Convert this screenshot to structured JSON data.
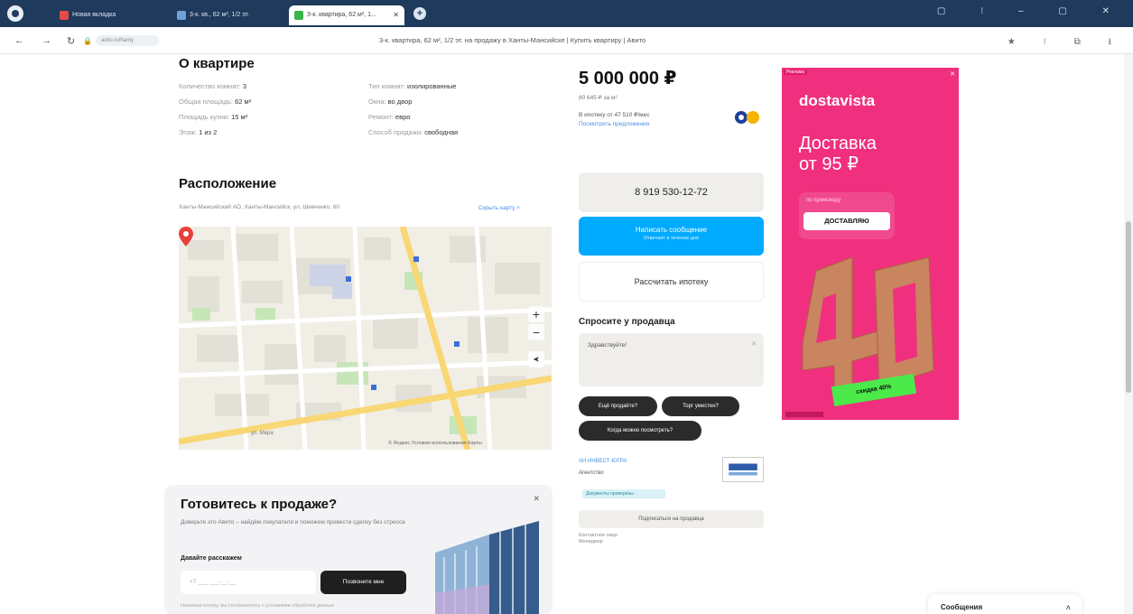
{
  "browser": {
    "tabs": [
      {
        "label": "Новая вкладка",
        "icon_color": "#e34a4a"
      },
      {
        "label": "3-к. кв., 62 м², 1/2 эт.",
        "icon_color": "#6fa0d8"
      },
      {
        "label": "3-к. квартира, 62 м², 1...",
        "icon_color": "#39b54a"
      }
    ],
    "page_title": "3-к. квартира, 62 м², 1/2 эт. на продажу в Ханты-Мансийске | Купить квартиру | Авито",
    "url_chip": "avito.ru/hanty",
    "new_tab_symbol": "+",
    "window_controls": "▢ ⁝ – ▢ ✕",
    "addr_right_icons": "★ ⁝ ⧉ ⭳",
    "nav_back": "←",
    "nav_forward": "→",
    "nav_reload": "↻",
    "nav_lock": "🔒"
  },
  "about": {
    "title": "О квартире",
    "left": [
      {
        "label": "Количество комнат: ",
        "value": "3"
      },
      {
        "label": "Общая площадь: ",
        "value": "62 м²"
      },
      {
        "label": "Площадь кухни: ",
        "value": "15 м²"
      },
      {
        "label": "Этаж: ",
        "value": "1 из 2"
      }
    ],
    "right": [
      {
        "label": "Тип комнат: ",
        "value": "изолированные"
      },
      {
        "label": "Окна: ",
        "value": "во двор"
      },
      {
        "label": "Ремонт: ",
        "value": "евро"
      },
      {
        "label": "Способ продажи: ",
        "value": "свободная"
      }
    ]
  },
  "location": {
    "title": "Расположение",
    "address": "Ханты-Мансийский АО, Ханты-Мансийск, ул. Шевченко, 60",
    "map_link": "Скрыть карту ˄",
    "zoom_in": "+",
    "zoom_out": "−",
    "locate": "➤",
    "map_copyright": "© Яндекс  Условия использования  Карты",
    "street_label": "ул. Мира"
  },
  "promo": {
    "title": "Готовитесь к продаже?",
    "desc": "Доверьте это Авито – найдём покупателя и поможем провести сделку без стресса",
    "input_label": "Давайте расскажем",
    "input_placeholder": "+7 ___ ___-__-__",
    "button": "Позвоните мне",
    "note": "Нажимая кнопку, вы соглашаетесь с условиями обработки данных",
    "close": "✕"
  },
  "price": {
    "value": "5 000 000 ₽",
    "per_meter": "80 645 ₽ за м²",
    "mortgage": "В ипотеку от 47 510 ₽/мес",
    "mortgage_link": "Посмотреть предложения"
  },
  "contacts": {
    "phone": "8 919 530-12-72",
    "message_button": "Написать сообщение",
    "message_sub": "Отвечает в течение дня",
    "mortgage_button": "Рассчитать ипотеку"
  },
  "ask": {
    "title": "Спросите у продавца",
    "placeholder": "Здравствуйте!",
    "close": "✕",
    "chips": [
      "Ещё продаёте?",
      "Торг уместен?",
      "Когда можно посмотреть?"
    ]
  },
  "seller": {
    "name_link": "АН ИНВЕСТ-ЮГРА",
    "since": "Агентство",
    "badge": "Документы проверены",
    "subscribe": "Подписаться на продавца",
    "meta": "Контактное лицо\nМенеджер"
  },
  "ad": {
    "tag": "Реклама",
    "brand": "dostavista",
    "headline_line1": "Доставка",
    "headline_line2": "от 95 ₽",
    "promo_label": "по промокоду",
    "promo_code": "ДОСТАВЛЯЮ",
    "discount": "скидка 40%",
    "big_number": "40",
    "corner": "✕"
  },
  "messages": {
    "label": "Сообщения",
    "chevron": "˄"
  },
  "colors": {
    "tabbar": "#1f3a5c",
    "accent_blue": "#00aaff",
    "ad_pink": "#f0307e",
    "ad_green": "#4bea4a",
    "pin_red": "#e8413b"
  }
}
